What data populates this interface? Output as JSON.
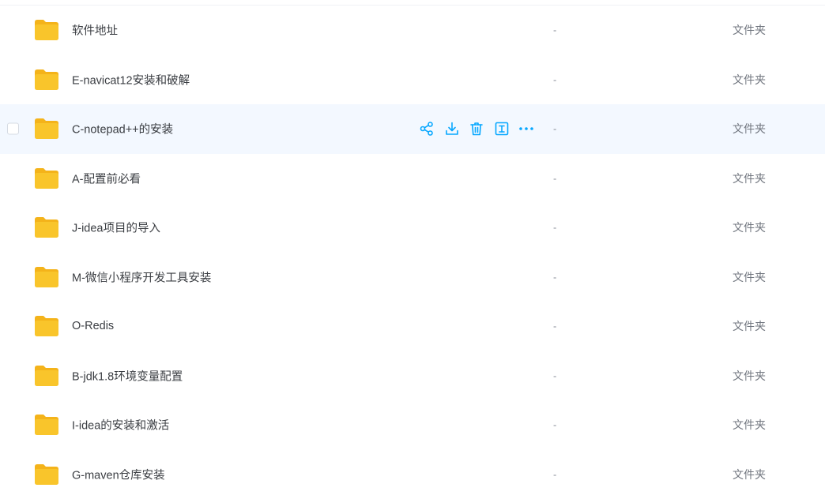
{
  "file_list": {
    "rows": [
      {
        "name": "软件地址",
        "size": "-",
        "type": "文件夹"
      },
      {
        "name": "E-navicat12安装和破解",
        "size": "-",
        "type": "文件夹"
      },
      {
        "name": "C-notepad++的安装",
        "size": "-",
        "type": "文件夹"
      },
      {
        "name": "A-配置前必看",
        "size": "-",
        "type": "文件夹"
      },
      {
        "name": "J-idea项目的导入",
        "size": "-",
        "type": "文件夹"
      },
      {
        "name": "M-微信小程序开发工具安装",
        "size": "-",
        "type": "文件夹"
      },
      {
        "name": "O-Redis",
        "size": "-",
        "type": "文件夹"
      },
      {
        "name": "B-jdk1.8环境变量配置",
        "size": "-",
        "type": "文件夹"
      },
      {
        "name": "I-idea的安装和激活",
        "size": "-",
        "type": "文件夹"
      },
      {
        "name": "G-maven仓库安装",
        "size": "-",
        "type": "文件夹"
      }
    ],
    "hovered_row_index": 2,
    "row_actions": [
      "share-icon",
      "download-icon",
      "trash-icon",
      "rename-icon",
      "more-icon"
    ]
  },
  "colors": {
    "folder": "#f9c52b",
    "folder_back": "#f4b31a",
    "accent": "#06a7ff",
    "row_highlight": "#f3f8ff",
    "text": "#3a3d42",
    "muted": "#71767f"
  }
}
